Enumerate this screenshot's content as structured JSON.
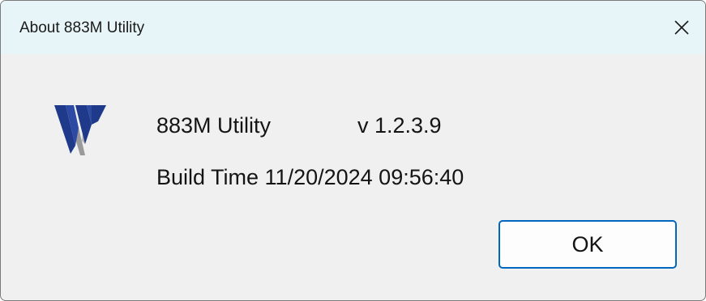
{
  "dialog": {
    "title": "About 883M Utility",
    "close_glyph": "✕"
  },
  "icons": {
    "close": "close-icon",
    "logo": "w-logo-icon"
  },
  "colors": {
    "titlebar": "#e7f5f9",
    "body": "#f0f0f0",
    "logo_blue": "#1f3a8a",
    "logo_shadow": "#8a8a8a",
    "ok_border": "#0067c0"
  },
  "content": {
    "app_name": "883M Utility",
    "version": "v 1.2.3.9",
    "build_time": "Build Time 11/20/2024 09:56:40"
  },
  "buttons": {
    "ok_label": "OK"
  }
}
